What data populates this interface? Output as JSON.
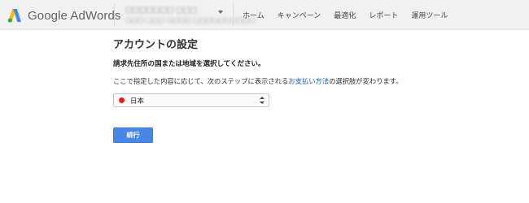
{
  "header": {
    "brand": "Google AdWords",
    "account": {
      "name": "□□□□□□□ □□□",
      "id": "□□□-□□□-□□□□  □□□□□□□□□□"
    },
    "nav": [
      "ホーム",
      "キャンペーン",
      "最適化",
      "レポート",
      "運用ツール"
    ]
  },
  "main": {
    "title": "アカウントの設定",
    "subtitle": "請求先住所の国または地域を選択してください。",
    "desc_before": "ここで指定した内容に応じて、次のステップに表示される",
    "desc_link": "お支払い方法",
    "desc_after": "の選択肢が変わります。",
    "country_select": {
      "value": "日本",
      "flag": "japan-flag"
    },
    "continue_label": "続行"
  },
  "colors": {
    "accent": "#4a86e8",
    "link": "#1a5fd0",
    "header_bg": "#f1f1f1"
  }
}
